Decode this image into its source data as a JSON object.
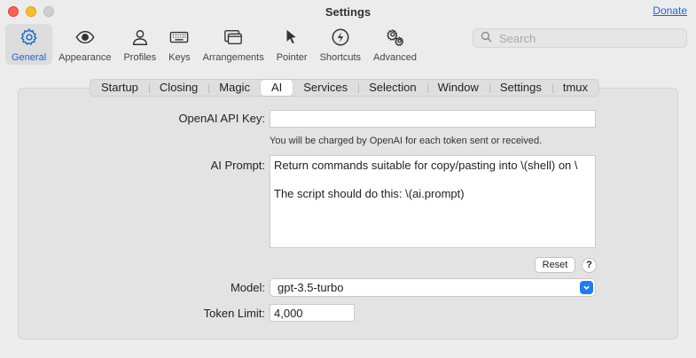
{
  "window": {
    "title": "Settings",
    "donate": "Donate"
  },
  "toolbar": {
    "items": [
      {
        "label": "General",
        "icon": "gear-icon",
        "active": true
      },
      {
        "label": "Appearance",
        "icon": "eye-icon"
      },
      {
        "label": "Profiles",
        "icon": "person-icon"
      },
      {
        "label": "Keys",
        "icon": "keyboard-icon"
      },
      {
        "label": "Arrangements",
        "icon": "windows-icon"
      },
      {
        "label": "Pointer",
        "icon": "pointer-icon"
      },
      {
        "label": "Shortcuts",
        "icon": "bolt-icon"
      },
      {
        "label": "Advanced",
        "icon": "gears-icon"
      }
    ],
    "search_placeholder": "Search"
  },
  "tabs": [
    "Startup",
    "Closing",
    "Magic",
    "AI",
    "Services",
    "Selection",
    "Window",
    "Settings",
    "tmux"
  ],
  "form": {
    "api_key_label": "OpenAI API Key:",
    "api_key_value": "",
    "charge_note": "You will be charged by OpenAI for each token sent or received.",
    "prompt_label": "AI Prompt:",
    "prompt_line1": "Return commands suitable for copy/pasting into \\(shell) on \\",
    "prompt_line2": "",
    "prompt_line3": "The script should do this: \\(ai.prompt)",
    "reset_label": "Reset",
    "help_label": "?",
    "model_label": "Model:",
    "model_value": "gpt-3.5-turbo",
    "token_label": "Token Limit:",
    "token_value": "4,000"
  },
  "colors": {
    "accent": "#1767d1",
    "link": "#1d63d6",
    "chevron_bg": "#1f7bf6"
  }
}
